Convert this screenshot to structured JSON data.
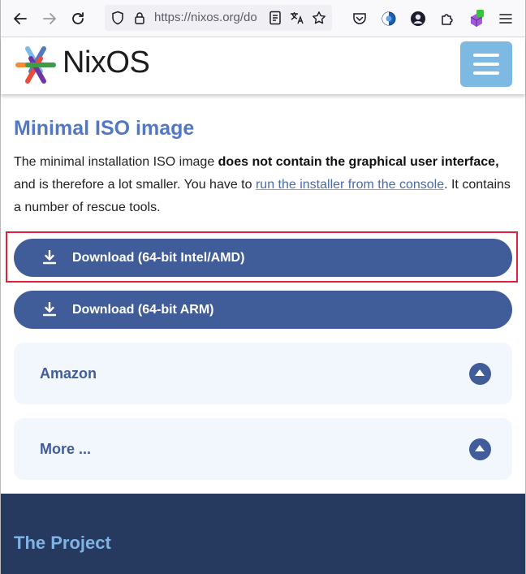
{
  "browser": {
    "url": "https://nixos.org/do",
    "icons": [
      "back-arrow-icon",
      "forward-arrow-icon",
      "reload-icon",
      "shield-icon",
      "lock-icon",
      "reader-view-icon",
      "translate-icon",
      "bookmark-star-icon",
      "pocket-icon",
      "extension-circle-icon",
      "account-avatar-icon",
      "extensions-puzzle-icon",
      "addon-cube-icon",
      "menu-icon"
    ]
  },
  "header": {
    "logo_text": "NixOS",
    "menu_icon": "hamburger-icon"
  },
  "section": {
    "title": "Minimal ISO image",
    "intro_prefix": "The minimal installation ISO image ",
    "intro_bold": "does not contain the graphical user interface,",
    "intro_middle": " and is therefore a lot smaller. You have to ",
    "intro_link": "run the installer from the console",
    "intro_suffix": ". It contains a number of rescue tools."
  },
  "downloads": [
    {
      "label": "Download (64-bit Intel/AMD)",
      "icon": "download-icon"
    },
    {
      "label": "Download (64-bit ARM)",
      "icon": "download-icon"
    }
  ],
  "accordions": [
    {
      "label": "Amazon"
    },
    {
      "label": "More ..."
    }
  ],
  "footer": {
    "title": "The Project"
  },
  "colors": {
    "accent": "#5277c3",
    "button": "#405d99",
    "highlight": "#e0213d",
    "footer": "#263a5f"
  }
}
